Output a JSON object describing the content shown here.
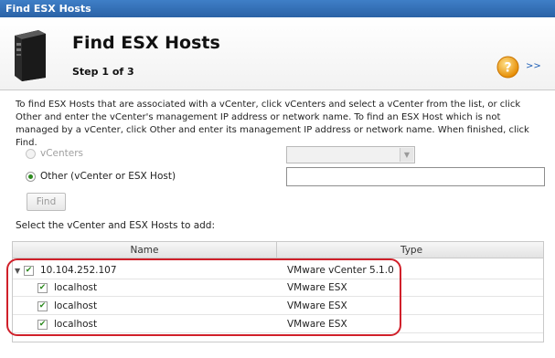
{
  "window": {
    "title": "Find ESX Hosts"
  },
  "header": {
    "title": "Find ESX Hosts",
    "step": "Step 1 of 3",
    "icon": "server-tower-icon",
    "help_icon": "help-icon",
    "next_label": ">>"
  },
  "description": "To find ESX Hosts that are associated with a vCenter, click vCenters and select a vCenter from the list, or click Other and enter the vCenter's management IP address or network name. To find an ESX Host which is not managed by a vCenter, click Other and enter its management IP address or network name. When finished, click Find.",
  "options": {
    "vcenters_label": "vCenters",
    "other_label": "Other (vCenter or ESX Host)",
    "selected": "other"
  },
  "vcenter_select": {
    "value": ""
  },
  "host_input": {
    "value": ""
  },
  "find_button": {
    "label": "Find"
  },
  "grid": {
    "caption": "Select the vCenter and ESX Hosts to add:",
    "columns": {
      "name": "Name",
      "type": "Type"
    },
    "rows": [
      {
        "name": "10.104.252.107",
        "type": "VMware vCenter 5.1.0",
        "checked": true,
        "level": 0
      },
      {
        "name": "localhost",
        "type": "VMware ESX",
        "checked": true,
        "level": 1
      },
      {
        "name": "localhost",
        "type": "VMware ESX",
        "checked": true,
        "level": 1
      },
      {
        "name": "localhost",
        "type": "VMware ESX",
        "checked": true,
        "level": 1
      }
    ]
  },
  "colors": {
    "title_bar": "#2a62a6",
    "highlight": "#d0202a",
    "check": "#2d8a1f"
  }
}
